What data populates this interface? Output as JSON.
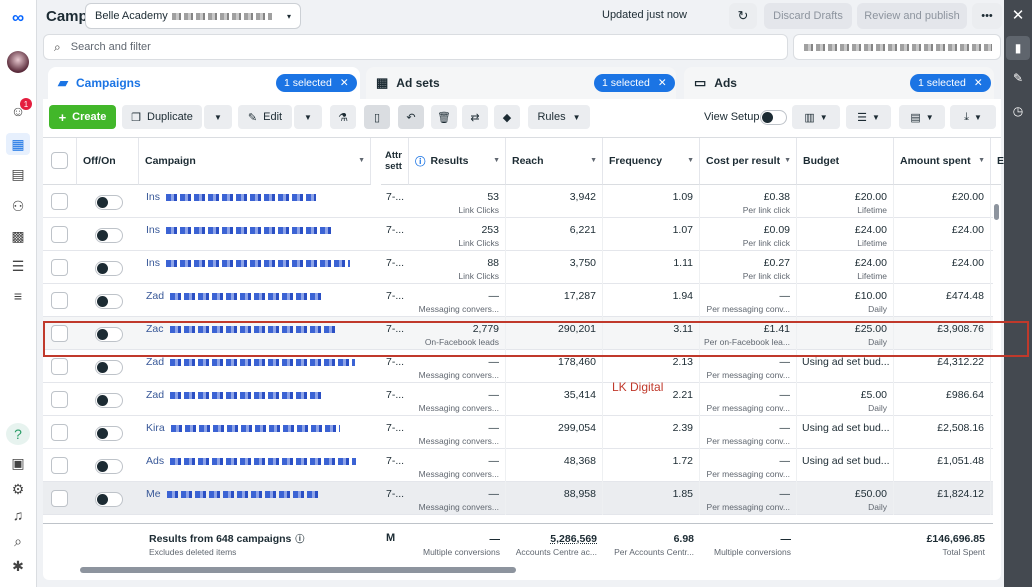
{
  "header": {
    "title": "Campaigns",
    "account_name": "Belle Academy",
    "updated": "Updated just now",
    "discard": "Discard Drafts",
    "review": "Review and publish",
    "more": "•••"
  },
  "search": {
    "placeholder": "Search and filter"
  },
  "tabs": [
    {
      "label": "Campaigns",
      "selected": "1 selected"
    },
    {
      "label": "Ad sets",
      "selected": "1 selected"
    },
    {
      "label": "Ads",
      "selected": "1 selected"
    }
  ],
  "toolbar": {
    "create": "Create",
    "duplicate": "Duplicate",
    "edit": "Edit",
    "rules": "Rules",
    "view_setup": "View Setup"
  },
  "columns": {
    "offon": "Off/On",
    "campaign": "Campaign",
    "attr": "Attr sett",
    "results": "Results",
    "reach": "Reach",
    "frequency": "Frequency",
    "cpr": "Cost per result",
    "budget": "Budget",
    "spent": "Amount spent",
    "extra": "E"
  },
  "rows": [
    {
      "name": "Ins",
      "attr": "7-...",
      "results": "53",
      "results_sub": "Link Clicks",
      "reach": "3,942",
      "freq": "1.09",
      "cpr": "£0.38",
      "cpr_sub": "Per link click",
      "budget": "£20.00",
      "budget_sub": "Lifetime",
      "spent": "£20.00"
    },
    {
      "name": "Ins",
      "attr": "7-...",
      "results": "253",
      "results_sub": "Link Clicks",
      "reach": "6,221",
      "freq": "1.07",
      "cpr": "£0.09",
      "cpr_sub": "Per link click",
      "budget": "£24.00",
      "budget_sub": "Lifetime",
      "spent": "£24.00"
    },
    {
      "name": "Ins",
      "attr": "7-...",
      "results": "88",
      "results_sub": "Link Clicks",
      "reach": "3,750",
      "freq": "1.11",
      "cpr": "£0.27",
      "cpr_sub": "Per link click",
      "budget": "£24.00",
      "budget_sub": "Lifetime",
      "spent": "£24.00"
    },
    {
      "name": "Zad",
      "attr": "7-...",
      "results": "—",
      "results_sub": "Messaging convers...",
      "reach": "17,287",
      "freq": "1.94",
      "cpr": "—",
      "cpr_sub": "Per messaging conv...",
      "budget": "£10.00",
      "budget_sub": "Daily",
      "spent": "£474.48"
    },
    {
      "name": "Zac",
      "attr": "7-...",
      "results": "2,779",
      "results_sub": "On-Facebook leads",
      "reach": "290,201",
      "freq": "3.11",
      "cpr": "£1.41",
      "cpr_sub": "Per on-Facebook lea...",
      "budget": "£25.00",
      "budget_sub": "Daily",
      "spent": "£3,908.76"
    },
    {
      "name": "Zad",
      "attr": "7-...",
      "results": "—",
      "results_sub": "Messaging convers...",
      "reach": "178,460",
      "freq": "2.13",
      "cpr": "—",
      "cpr_sub": "Per messaging conv...",
      "budget": "Using ad set bud...",
      "budget_sub": "",
      "spent": "£4,312.22"
    },
    {
      "name": "Zad",
      "attr": "7-...",
      "results": "—",
      "results_sub": "Messaging convers...",
      "reach": "35,414",
      "freq": "2.21",
      "cpr": "—",
      "cpr_sub": "Per messaging conv...",
      "budget": "£5.00",
      "budget_sub": "Daily",
      "spent": "£986.64"
    },
    {
      "name": "Kira",
      "attr": "7-...",
      "results": "—",
      "results_sub": "Messaging convers...",
      "reach": "299,054",
      "freq": "2.39",
      "cpr": "—",
      "cpr_sub": "Per messaging conv...",
      "budget": "Using ad set bud...",
      "budget_sub": "",
      "spent": "£2,508.16"
    },
    {
      "name": "Ads",
      "attr": "7-...",
      "results": "—",
      "results_sub": "Messaging convers...",
      "reach": "48,368",
      "freq": "1.72",
      "cpr": "—",
      "cpr_sub": "Per messaging conv...",
      "budget": "Using ad set bud...",
      "budget_sub": "",
      "spent": "£1,051.48"
    },
    {
      "name": "Me",
      "attr": "7-...",
      "results": "—",
      "results_sub": "Messaging convers...",
      "reach": "88,958",
      "freq": "1.85",
      "cpr": "—",
      "cpr_sub": "Per messaging conv...",
      "budget": "£50.00",
      "budget_sub": "Daily",
      "spent": "£1,824.12"
    }
  ],
  "footer": {
    "label": "Results from 648 campaigns",
    "sub": "Excludes deleted items",
    "attr": "M",
    "results": "—",
    "results_sub": "Multiple conversions",
    "reach": "5,286,569",
    "reach_sub": "Accounts Centre ac...",
    "freq": "6.98",
    "freq_sub": "Per Accounts Centr...",
    "cpr": "—",
    "cpr_sub": "Multiple conversions",
    "spent": "£146,696.85",
    "spent_sub": "Total Spent"
  },
  "watermark": "LK Digital",
  "badge": "1",
  "colors": {
    "primary": "#1b74e4",
    "create": "#42b72a",
    "highlight": "#c0392b"
  }
}
